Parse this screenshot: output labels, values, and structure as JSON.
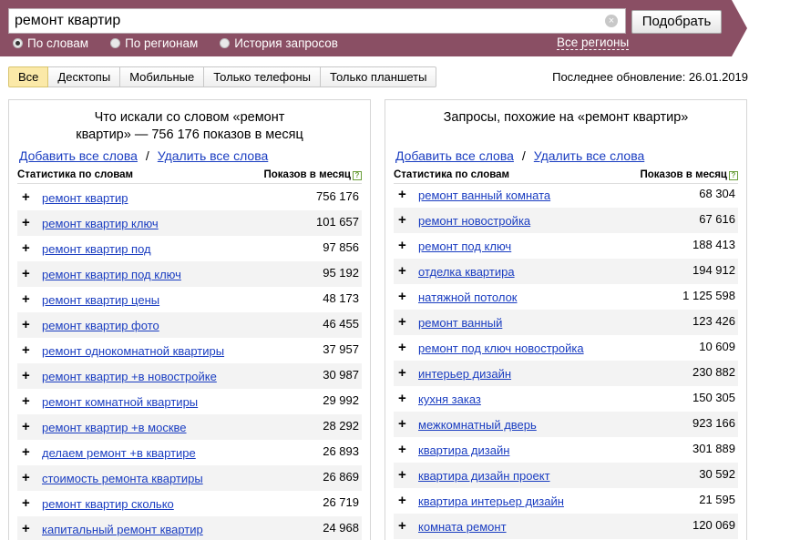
{
  "colors": {
    "band": "#8a4f64",
    "link": "#1a3dc1",
    "active_tab": "#fbe9a8"
  },
  "search": {
    "value": "ремонт квартир",
    "submit_label": "Подобрать"
  },
  "modes": [
    {
      "label": "По словам",
      "selected": true
    },
    {
      "label": "По регионам",
      "selected": false
    },
    {
      "label": "История запросов",
      "selected": false
    }
  ],
  "regions_link": "Все регионы",
  "tabs": [
    "Все",
    "Десктопы",
    "Мобильные",
    "Только телефоны",
    "Только планшеты"
  ],
  "active_tab": "Все",
  "last_update": "Последнее обновление: 26.01.2019",
  "left_panel": {
    "title_line1": "Что искали со словом «ремонт",
    "title_line2": "квартир» — 756 176 показов в месяц",
    "add_all": "Добавить все слова",
    "separator": "/",
    "remove_all": "Удалить все слова",
    "col_phrase": "Статистика по словам",
    "col_count": "Показов в месяц",
    "help": "?",
    "rows": [
      {
        "phrase": "ремонт квартир",
        "count": "756 176"
      },
      {
        "phrase": "ремонт квартир ключ",
        "count": "101 657"
      },
      {
        "phrase": "ремонт квартир под",
        "count": "97 856"
      },
      {
        "phrase": "ремонт квартир под ключ",
        "count": "95 192"
      },
      {
        "phrase": "ремонт квартир цены",
        "count": "48 173"
      },
      {
        "phrase": "ремонт квартир фото",
        "count": "46 455"
      },
      {
        "phrase": "ремонт однокомнатной квартиры",
        "count": "37 957"
      },
      {
        "phrase": "ремонт квартир +в новостройке",
        "count": "30 987"
      },
      {
        "phrase": "ремонт комнатной квартиры",
        "count": "29 992"
      },
      {
        "phrase": "ремонт квартир +в москве",
        "count": "28 292"
      },
      {
        "phrase": "делаем ремонт +в квартире",
        "count": "26 893"
      },
      {
        "phrase": "стоимость ремонта квартиры",
        "count": "26 869"
      },
      {
        "phrase": "ремонт квартир сколько",
        "count": "26 719"
      },
      {
        "phrase": "капитальный ремонт квартир",
        "count": "24 968"
      }
    ]
  },
  "right_panel": {
    "title": "Запросы, похожие на «ремонт квартир»",
    "add_all": "Добавить все слова",
    "separator": "/",
    "remove_all": "Удалить все слова",
    "col_phrase": "Статистика по словам",
    "col_count": "Показов в месяц",
    "help": "?",
    "rows": [
      {
        "phrase": "ремонт ванный комната",
        "count": "68 304"
      },
      {
        "phrase": "ремонт новостройка",
        "count": "67 616"
      },
      {
        "phrase": "ремонт под ключ",
        "count": "188 413"
      },
      {
        "phrase": "отделка квартира",
        "count": "194 912"
      },
      {
        "phrase": "натяжной потолок",
        "count": "1 125 598"
      },
      {
        "phrase": "ремонт ванный",
        "count": "123 426"
      },
      {
        "phrase": "ремонт под ключ новостройка",
        "count": "10 609"
      },
      {
        "phrase": "интерьер дизайн",
        "count": "230 882"
      },
      {
        "phrase": "кухня заказ",
        "count": "150 305"
      },
      {
        "phrase": "межкомнатный дверь",
        "count": "923 166"
      },
      {
        "phrase": "квартира дизайн",
        "count": "301 889"
      },
      {
        "phrase": "квартира дизайн проект",
        "count": "30 592"
      },
      {
        "phrase": "квартира интерьер дизайн",
        "count": "21 595"
      },
      {
        "phrase": "комната ремонт",
        "count": "120 069"
      }
    ]
  }
}
